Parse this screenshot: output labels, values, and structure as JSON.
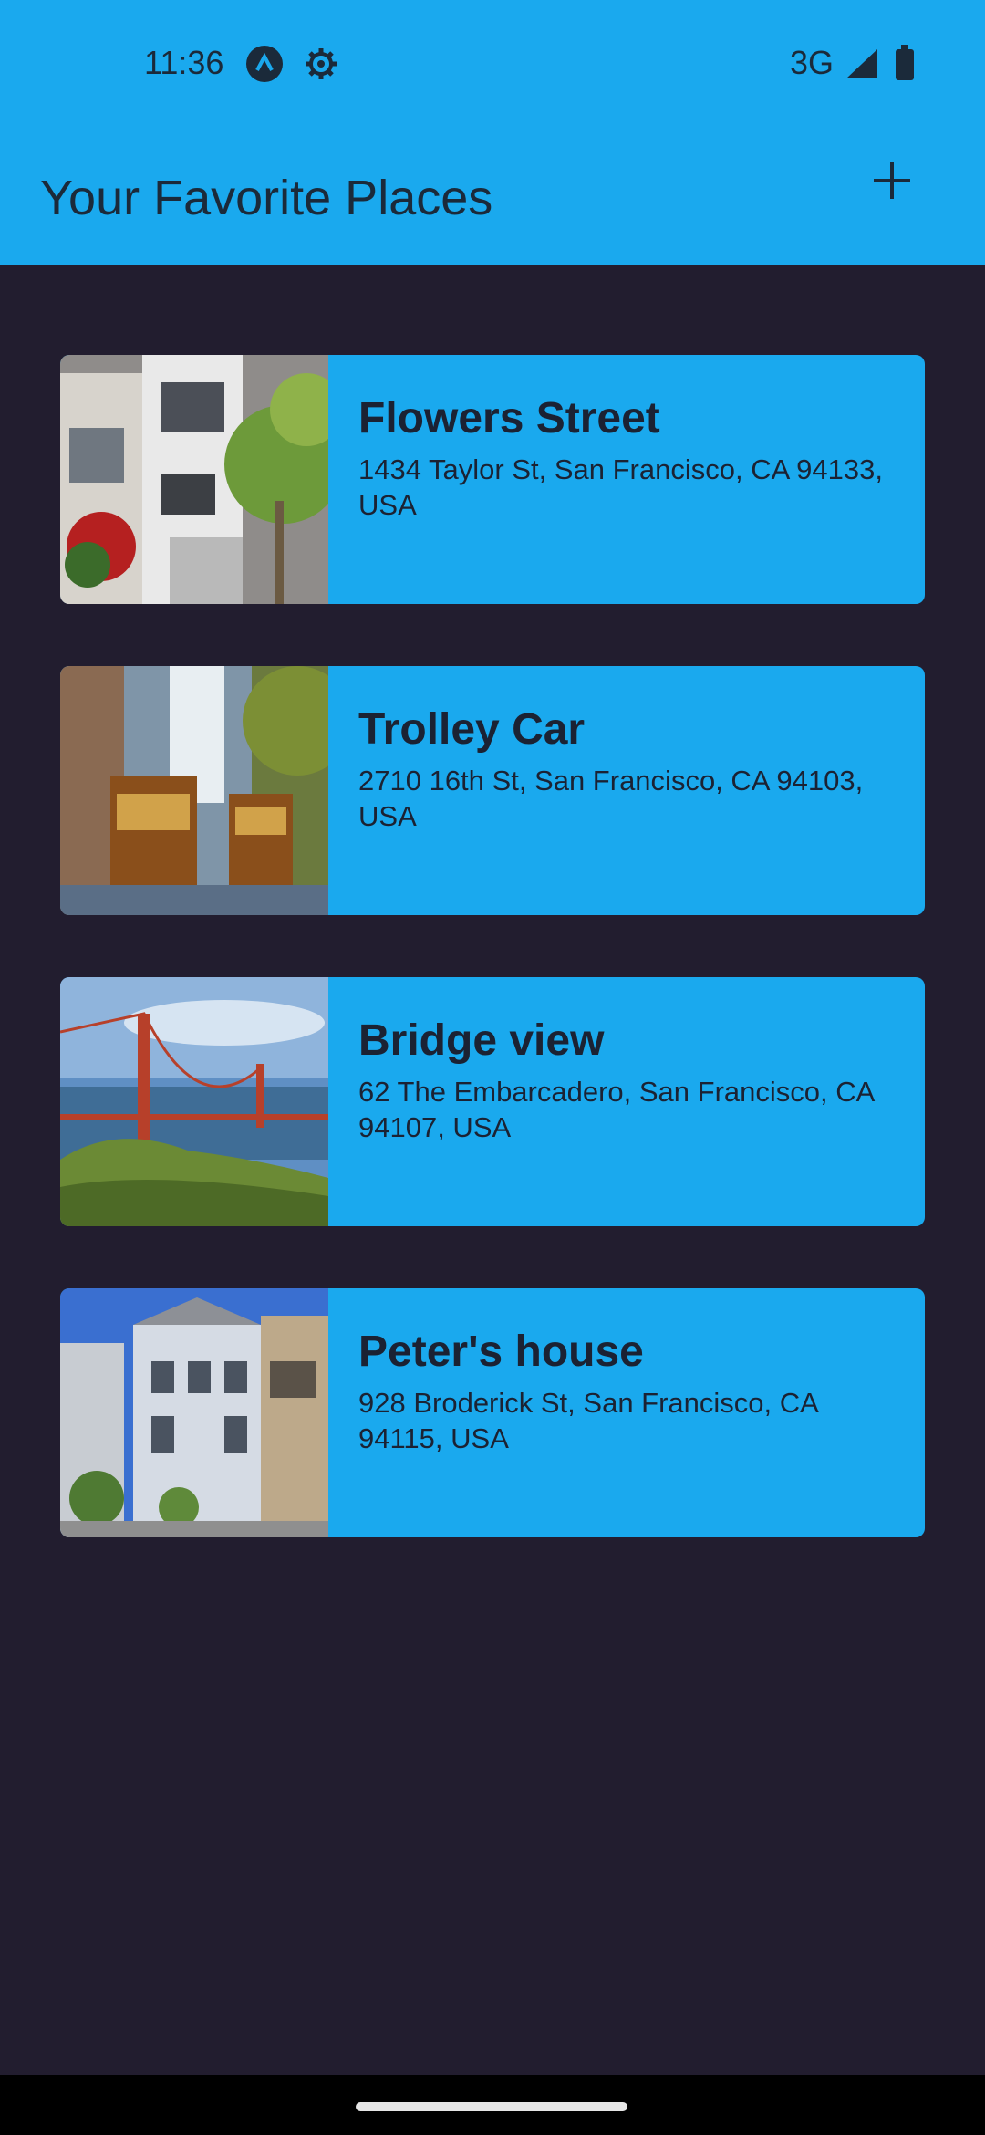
{
  "status": {
    "time": "11:36",
    "network": "3G",
    "icons": [
      "app-notification-icon",
      "gear-icon",
      "signal-icon",
      "battery-icon"
    ]
  },
  "app_bar": {
    "title": "Your Favorite Places",
    "add_icon": "plus-icon"
  },
  "places": [
    {
      "title": "Flowers Street",
      "address": "1434 Taylor St, San Francisco, CA 94133, USA",
      "image": "townhouse-street-photo"
    },
    {
      "title": "Trolley Car",
      "address": "2710 16th St, San Francisco, CA 94103, USA",
      "image": "cable-car-photo"
    },
    {
      "title": "Bridge view",
      "address": "62 The Embarcadero, San Francisco, CA 94107, USA",
      "image": "golden-gate-bridge-photo"
    },
    {
      "title": "Peter's house",
      "address": "928 Broderick St, San Francisco, CA 94115, USA",
      "image": "victorian-house-photo"
    }
  ],
  "colors": {
    "accent": "#1aa9ee",
    "background": "#221d2f",
    "text": "#1b2233"
  }
}
